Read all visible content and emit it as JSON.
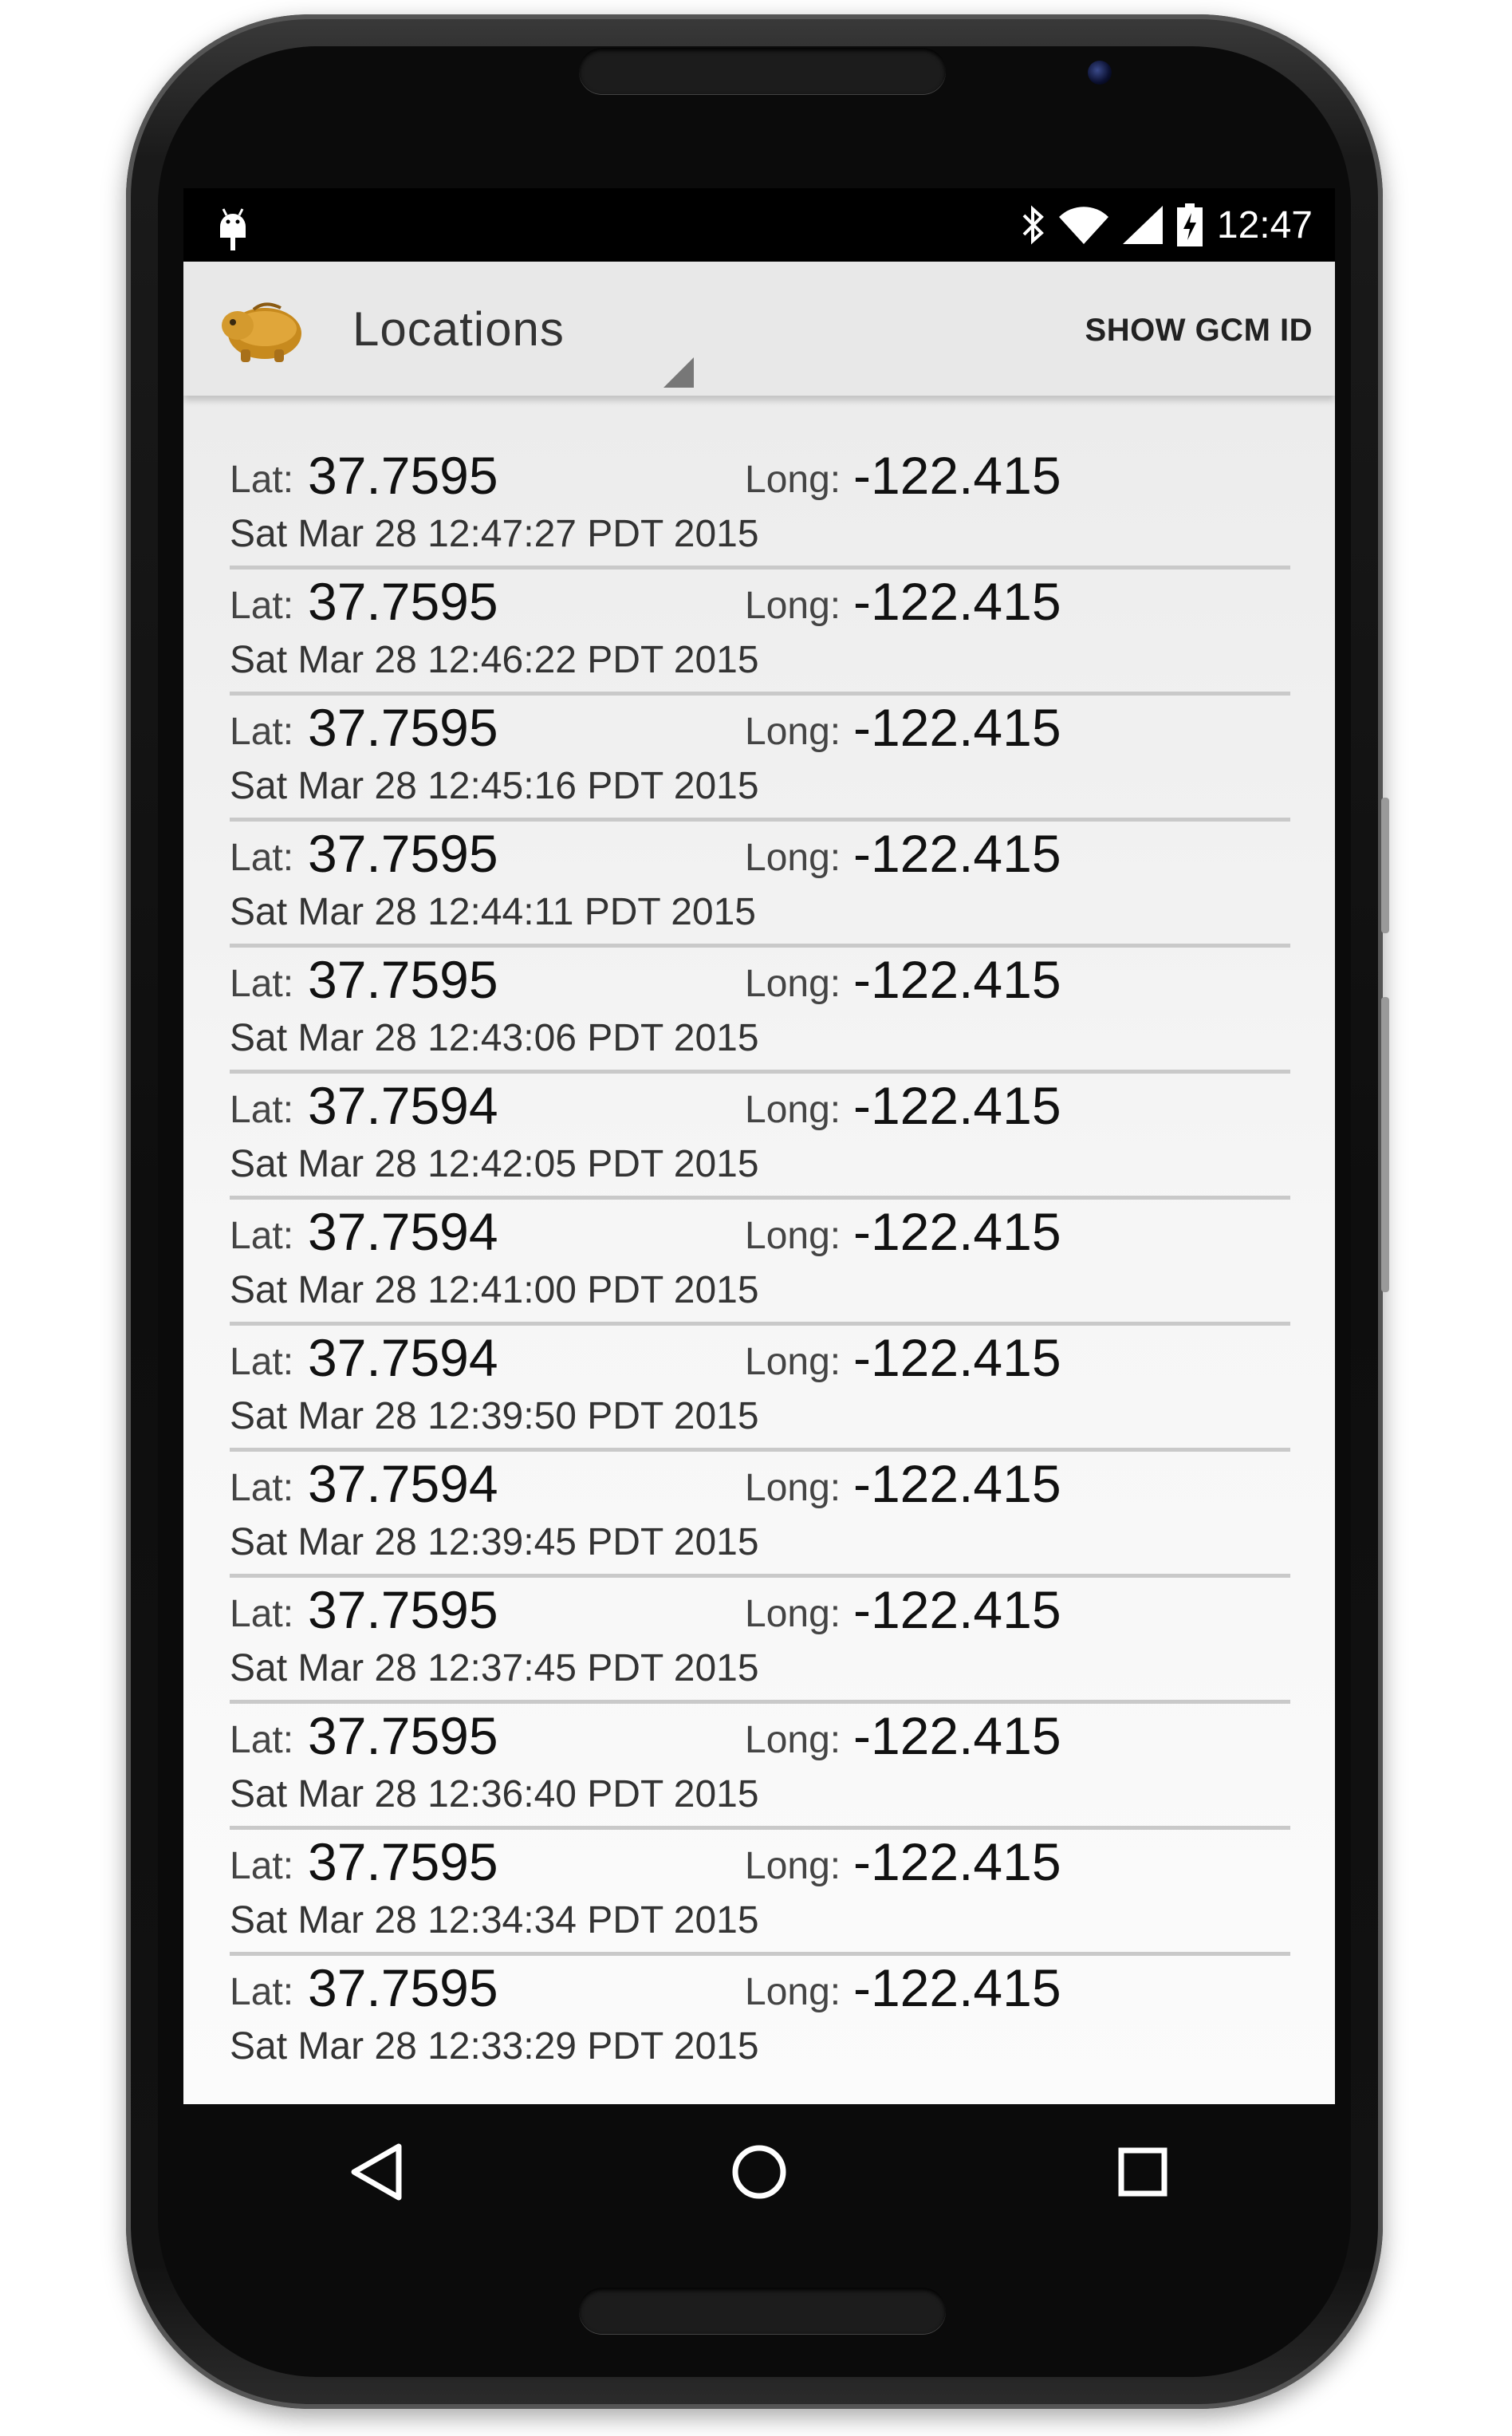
{
  "status_bar": {
    "time": "12:47",
    "icons": [
      "android-debug-icon",
      "bluetooth-icon",
      "wifi-icon",
      "cell-signal-icon",
      "battery-charging-icon"
    ]
  },
  "action_bar": {
    "title": "Locations",
    "action_label": "SHOW GCM ID",
    "icon": "app-logo-icon"
  },
  "list": {
    "lat_label": "Lat:",
    "long_label": "Long:",
    "items": [
      {
        "lat": "37.7595",
        "long": "-122.415",
        "time": "Sat Mar 28 12:47:27 PDT 2015"
      },
      {
        "lat": "37.7595",
        "long": "-122.415",
        "time": "Sat Mar 28 12:46:22 PDT 2015"
      },
      {
        "lat": "37.7595",
        "long": "-122.415",
        "time": "Sat Mar 28 12:45:16 PDT 2015"
      },
      {
        "lat": "37.7595",
        "long": "-122.415",
        "time": "Sat Mar 28 12:44:11 PDT 2015"
      },
      {
        "lat": "37.7595",
        "long": "-122.415",
        "time": "Sat Mar 28 12:43:06 PDT 2015"
      },
      {
        "lat": "37.7594",
        "long": "-122.415",
        "time": "Sat Mar 28 12:42:05 PDT 2015"
      },
      {
        "lat": "37.7594",
        "long": "-122.415",
        "time": "Sat Mar 28 12:41:00 PDT 2015"
      },
      {
        "lat": "37.7594",
        "long": "-122.415",
        "time": "Sat Mar 28 12:39:50 PDT 2015"
      },
      {
        "lat": "37.7594",
        "long": "-122.415",
        "time": "Sat Mar 28 12:39:45 PDT 2015"
      },
      {
        "lat": "37.7595",
        "long": "-122.415",
        "time": "Sat Mar 28 12:37:45 PDT 2015"
      },
      {
        "lat": "37.7595",
        "long": "-122.415",
        "time": "Sat Mar 28 12:36:40 PDT 2015"
      },
      {
        "lat": "37.7595",
        "long": "-122.415",
        "time": "Sat Mar 28 12:34:34 PDT 2015"
      },
      {
        "lat": "37.7595",
        "long": "-122.415",
        "time": "Sat Mar 28 12:33:29 PDT 2015"
      }
    ]
  },
  "nav_bar": {
    "buttons": [
      "back-icon",
      "home-icon",
      "recents-icon"
    ]
  }
}
